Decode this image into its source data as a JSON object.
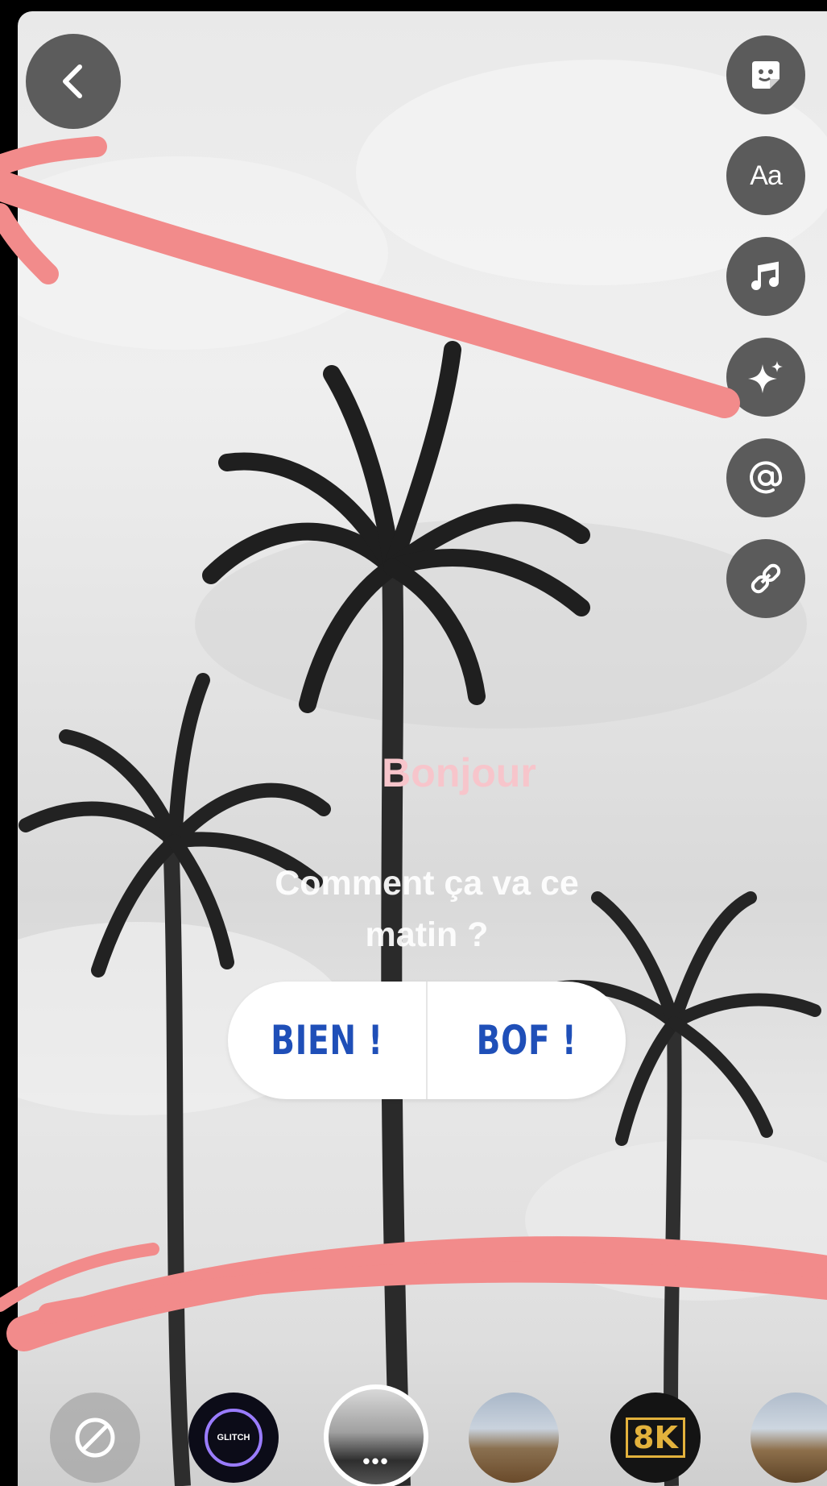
{
  "sticker": {
    "title": "Bonjour",
    "question": "Comment ça va ce matin ?",
    "options": [
      "BIEN !",
      "BOF !"
    ]
  },
  "toolbar": {
    "icons": [
      "sticker-icon",
      "text-icon",
      "music-icon",
      "effects-icon",
      "mention-icon",
      "link-icon"
    ],
    "text_label": "Aa"
  },
  "filters": {
    "glitch_label": "GLITCH",
    "selected_more": "•••",
    "eightk_label": "8K"
  },
  "colors": {
    "annotation": "#f28b8b",
    "poll_text": "#1f4fb8",
    "title": "#f7c5cb",
    "tool_bg": "#5b5b5b"
  }
}
